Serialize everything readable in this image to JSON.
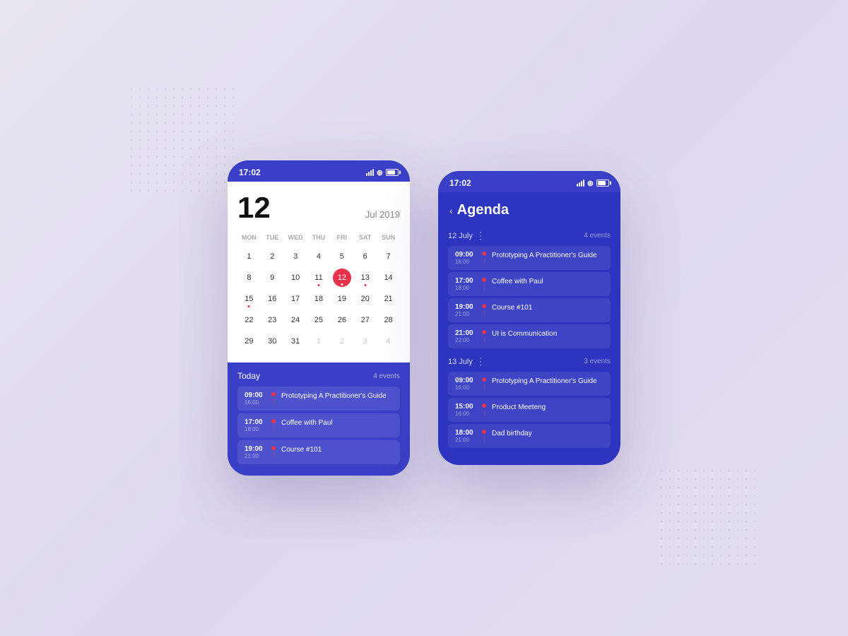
{
  "phone1": {
    "status": {
      "time": "17:02"
    },
    "calendar": {
      "day": "12",
      "month_year": "Jul 2019",
      "weekdays": [
        "MON",
        "TUE",
        "WED",
        "THU",
        "FRI",
        "SAT",
        "SUN"
      ],
      "weeks": [
        [
          {
            "day": "1",
            "selected": false,
            "dot": false,
            "other": false
          },
          {
            "day": "2",
            "selected": false,
            "dot": false,
            "other": false
          },
          {
            "day": "3",
            "selected": false,
            "dot": false,
            "other": false
          },
          {
            "day": "4",
            "selected": false,
            "dot": false,
            "other": false
          },
          {
            "day": "5",
            "selected": false,
            "dot": false,
            "other": false
          },
          {
            "day": "6",
            "selected": false,
            "dot": false,
            "other": false
          },
          {
            "day": "7",
            "selected": false,
            "dot": false,
            "other": false
          }
        ],
        [
          {
            "day": "8",
            "selected": false,
            "dot": false,
            "other": false
          },
          {
            "day": "9",
            "selected": false,
            "dot": false,
            "other": false
          },
          {
            "day": "10",
            "selected": false,
            "dot": false,
            "other": false
          },
          {
            "day": "11",
            "selected": false,
            "dot": true,
            "other": false
          },
          {
            "day": "12",
            "selected": true,
            "dot": true,
            "other": false
          },
          {
            "day": "13",
            "selected": false,
            "dot": true,
            "other": false
          },
          {
            "day": "14",
            "selected": false,
            "dot": false,
            "other": false
          }
        ],
        [
          {
            "day": "15",
            "selected": false,
            "dot": true,
            "other": false
          },
          {
            "day": "16",
            "selected": false,
            "dot": false,
            "other": false
          },
          {
            "day": "17",
            "selected": false,
            "dot": false,
            "other": false
          },
          {
            "day": "18",
            "selected": false,
            "dot": false,
            "other": false
          },
          {
            "day": "19",
            "selected": false,
            "dot": false,
            "other": false
          },
          {
            "day": "20",
            "selected": false,
            "dot": false,
            "other": false
          },
          {
            "day": "21",
            "selected": false,
            "dot": false,
            "other": false
          }
        ],
        [
          {
            "day": "22",
            "selected": false,
            "dot": false,
            "other": false
          },
          {
            "day": "23",
            "selected": false,
            "dot": false,
            "other": false
          },
          {
            "day": "24",
            "selected": false,
            "dot": false,
            "other": false
          },
          {
            "day": "25",
            "selected": false,
            "dot": false,
            "other": false
          },
          {
            "day": "26",
            "selected": false,
            "dot": false,
            "other": false
          },
          {
            "day": "27",
            "selected": false,
            "dot": false,
            "other": false
          },
          {
            "day": "28",
            "selected": false,
            "dot": false,
            "other": false
          }
        ],
        [
          {
            "day": "29",
            "selected": false,
            "dot": false,
            "other": false
          },
          {
            "day": "30",
            "selected": false,
            "dot": false,
            "other": false
          },
          {
            "day": "31",
            "selected": false,
            "dot": false,
            "other": false
          },
          {
            "day": "1",
            "selected": false,
            "dot": false,
            "other": true
          },
          {
            "day": "2",
            "selected": false,
            "dot": false,
            "other": true
          },
          {
            "day": "3",
            "selected": false,
            "dot": false,
            "other": true
          },
          {
            "day": "4",
            "selected": false,
            "dot": false,
            "other": true
          }
        ]
      ]
    },
    "agenda": {
      "date_label": "Today",
      "event_count": "4 events",
      "events": [
        {
          "time_start": "09:00",
          "time_end": "16:00",
          "title": "Prototyping A Practitioner's Guide"
        },
        {
          "time_start": "17:00",
          "time_end": "18:00",
          "title": "Coffee with Paul"
        },
        {
          "time_start": "19:00",
          "time_end": "21:00",
          "title": "Course #101"
        }
      ]
    }
  },
  "phone2": {
    "status": {
      "time": "17:02"
    },
    "title": "Agenda",
    "back_label": "‹",
    "day_groups": [
      {
        "date": "12 July",
        "count": "4 events",
        "events": [
          {
            "time_start": "09:00",
            "time_end": "16:00",
            "title": "Prototyping A Practitioner's Guide"
          },
          {
            "time_start": "17:00",
            "time_end": "18:00",
            "title": "Coffee with Paul"
          },
          {
            "time_start": "19:00",
            "time_end": "21:00",
            "title": "Course #101"
          },
          {
            "time_start": "21:00",
            "time_end": "22:00",
            "title": "UI is Communication"
          }
        ]
      },
      {
        "date": "13 July",
        "count": "3 events",
        "events": [
          {
            "time_start": "09:00",
            "time_end": "16:00",
            "title": "Prototyping A Practitioner's Guide"
          },
          {
            "time_start": "15:00",
            "time_end": "16:00",
            "title": "Product Meeteng"
          },
          {
            "time_start": "18:00",
            "time_end": "21:00",
            "title": "Dad birthday"
          }
        ]
      }
    ]
  }
}
